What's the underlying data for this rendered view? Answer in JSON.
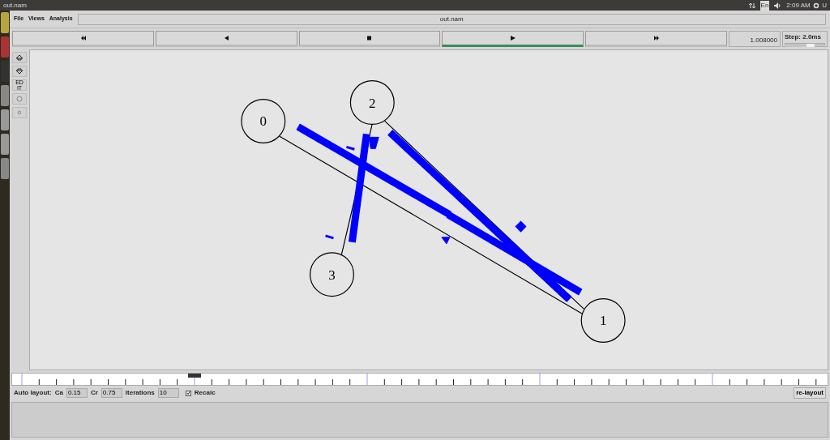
{
  "top_bar": {
    "title": "out.nam",
    "keyboard": "En",
    "clock": "2:09 AM",
    "user": "U"
  },
  "menu": [
    {
      "label": "File"
    },
    {
      "label": "Views"
    },
    {
      "label": "Analysis"
    }
  ],
  "file_label": "out.nam",
  "transport": [
    {
      "kind": "rewind",
      "selected": false
    },
    {
      "kind": "back",
      "selected": false
    },
    {
      "kind": "stop",
      "selected": false
    },
    {
      "kind": "play",
      "selected": true
    },
    {
      "kind": "forward",
      "selected": false
    }
  ],
  "time": "1.008000",
  "step": {
    "label": "Step: 2.0ms",
    "level": 0.75
  },
  "tools": [
    {
      "kind": "zoom-in"
    },
    {
      "kind": "zoom-out"
    },
    {
      "kind": "edit",
      "label": "ED IT"
    },
    {
      "kind": "circle"
    },
    {
      "kind": "dot"
    }
  ],
  "nodes": [
    {
      "label": "0"
    },
    {
      "label": "1"
    },
    {
      "label": "2"
    },
    {
      "label": "3"
    }
  ],
  "auto_layout": {
    "label": "Auto layout:",
    "ca_label": "Ca",
    "ca": "0.15",
    "cr_label": "Cr",
    "cr": "0.75",
    "iterations_label": "Iterations",
    "iterations": "10",
    "recalc_label": "Recalc",
    "recalc_checked": true,
    "relayout": "re-layout"
  }
}
